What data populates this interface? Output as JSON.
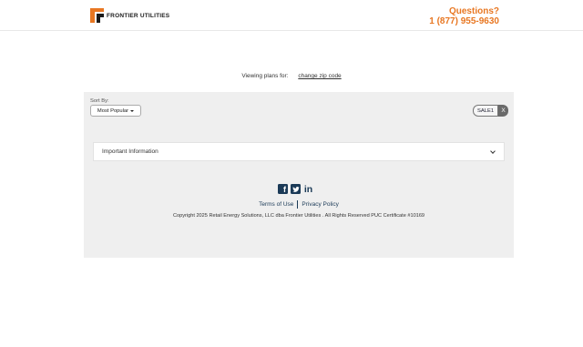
{
  "header": {
    "logo_text": "FRONTIER UTILITIES",
    "contact_question": "Questions?",
    "contact_phone": "1 (877) 955-9630",
    "accent_color": "#e87722"
  },
  "viewing": {
    "label": "Viewing plans for:",
    "change_zip": "change zip code"
  },
  "sort": {
    "label": "Sort By:",
    "selected": "Most Popular"
  },
  "promo": {
    "code": "SALE1",
    "remove": "X"
  },
  "important_info": {
    "label": "Important Information"
  },
  "footer": {
    "social_icons": [
      "facebook-icon",
      "twitter-icon",
      "linkedin-icon"
    ],
    "terms": "Terms of Use",
    "privacy": "Privacy Policy",
    "copyright": "Copyright 2025 Retail Energy Solutions, LLC dba Frontier Utilities . All Rights Reserved PUC Certificate #10169",
    "brand_color": "#1b3a57"
  }
}
